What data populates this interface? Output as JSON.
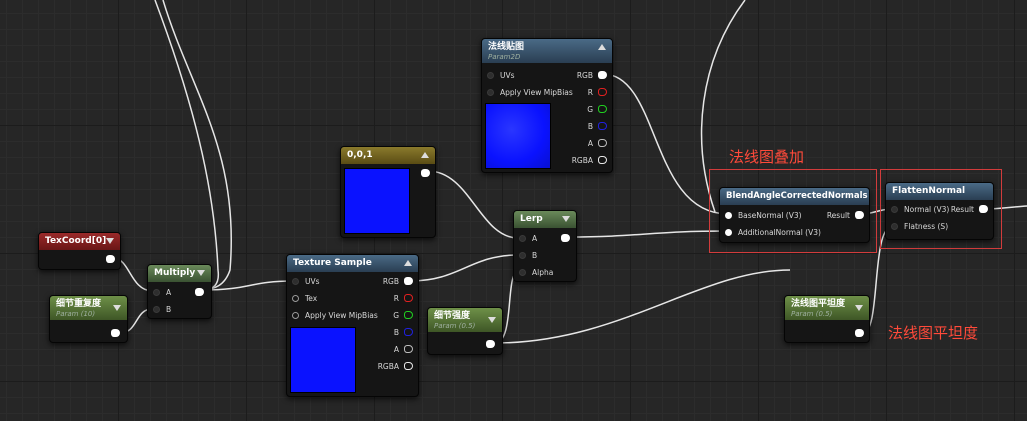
{
  "nodes": {
    "normal_tex": {
      "title": "法线贴图",
      "subtitle": "Param2D",
      "inputs": [
        "UVs",
        "Apply View MipBias"
      ],
      "outputs": [
        "RGB",
        "R",
        "G",
        "B",
        "A",
        "RGBA"
      ]
    },
    "const3": {
      "title": "0,0,1"
    },
    "texcoord": {
      "title": "TexCoord[0]"
    },
    "multiply": {
      "title": "Multiply",
      "inputs": [
        "A",
        "B"
      ]
    },
    "detail_repeat": {
      "title": "细节重复度",
      "subtitle": "Param (10)"
    },
    "texture_sample": {
      "title": "Texture Sample",
      "inputs": [
        "UVs",
        "Tex",
        "Apply View MipBias"
      ],
      "outputs": [
        "RGB",
        "R",
        "G",
        "B",
        "A",
        "RGBA"
      ]
    },
    "detail_strength": {
      "title": "细节强度",
      "subtitle": "Param (0.5)"
    },
    "lerp": {
      "title": "Lerp",
      "inputs": [
        "A",
        "B",
        "Alpha"
      ]
    },
    "blend": {
      "title": "BlendAngleCorrectedNormals",
      "inputs": [
        "BaseNormal (V3)",
        "AdditionalNormal (V3)"
      ],
      "output": "Result"
    },
    "flatten": {
      "title": "FlattenNormal",
      "inputs": [
        "Normal (V3)",
        "Flatness (S)"
      ],
      "output": "Result"
    },
    "flatness_param": {
      "title": "法线图平坦度",
      "subtitle": "Param (0.5)"
    }
  },
  "annotations": {
    "blend_label": "法线图叠加",
    "flatness_label": "法线图平坦度"
  },
  "colors": {
    "param_header": "#5a7a3a",
    "function_header": "#3e5a72",
    "constant_header": "#6e5e22",
    "texcoord_header": "#7a2222",
    "annotation": "#ff4a3a",
    "wire": "#e6e6e6",
    "texture_preview": "#0a12ff"
  }
}
